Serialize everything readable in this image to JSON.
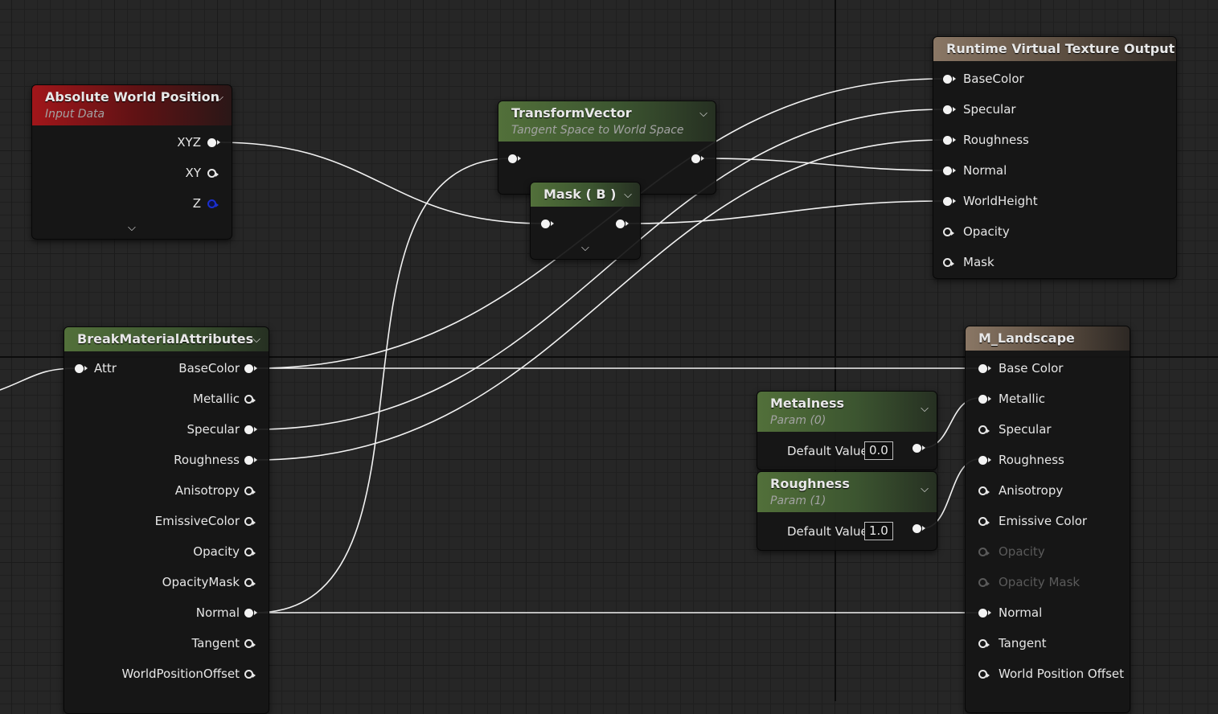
{
  "colors": {
    "function_header": "#a1161a",
    "param_header": "#52703a",
    "output_header": "#8a7765",
    "wire": "#f2f2f2"
  },
  "icons": {
    "collapse": "chevron-down-icon",
    "pin": "exec-pin-icon"
  },
  "nodes": {
    "abs_world_pos": {
      "title": "Absolute World Position",
      "subtitle": "Input Data",
      "pins": [
        "XYZ",
        "XY",
        "Z"
      ]
    },
    "transform_vector": {
      "title": "TransformVector",
      "subtitle": "Tangent Space to World Space"
    },
    "mask": {
      "title": "Mask ( B )"
    },
    "rvt_output": {
      "title": "Runtime Virtual Texture Output",
      "pins": [
        "BaseColor",
        "Specular",
        "Roughness",
        "Normal",
        "WorldHeight",
        "Opacity",
        "Mask"
      ]
    },
    "break_attrs": {
      "title": "BreakMaterialAttributes",
      "input": "Attr",
      "pins": [
        "BaseColor",
        "Metallic",
        "Specular",
        "Roughness",
        "Anisotropy",
        "EmissiveColor",
        "Opacity",
        "OpacityMask",
        "Normal",
        "Tangent",
        "WorldPositionOffset"
      ]
    },
    "metalness": {
      "title": "Metalness",
      "subtitle": "Param (0)",
      "default_label": "Default Value",
      "default_value": "0.0"
    },
    "roughness": {
      "title": "Roughness",
      "subtitle": "Param (1)",
      "default_label": "Default Value",
      "default_value": "1.0"
    },
    "m_landscape": {
      "title": "M_Landscape",
      "pins": [
        "Base Color",
        "Metallic",
        "Specular",
        "Roughness",
        "Anisotropy",
        "Emissive Color",
        "Opacity",
        "Opacity Mask",
        "Normal",
        "Tangent",
        "World Position Offset"
      ]
    }
  }
}
